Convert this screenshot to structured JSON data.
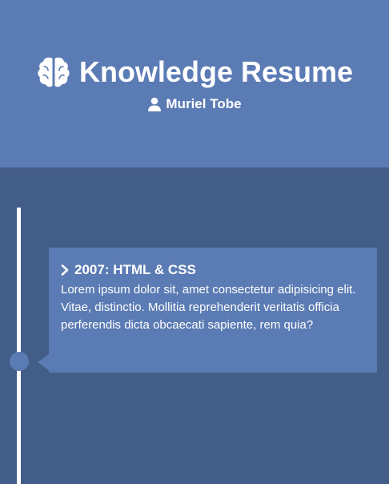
{
  "header": {
    "title": "Knowledge Resume",
    "title_icon": "brain-icon",
    "author": "Muriel Tobe",
    "author_icon": "user-icon",
    "background_color": "#5b7bb4"
  },
  "timeline": {
    "background_color": "#425d87",
    "line_color": "#ffffff",
    "entries": [
      {
        "icon": "chevron-right-icon",
        "heading": "2007: HTML & CSS",
        "body": "Lorem ipsum dolor sit, amet consectetur adipisicing elit. Vitae, distinctio. Mollitia reprehenderit veritatis officia perferendis dicta obcaecati sapiente, rem quia?"
      }
    ]
  }
}
